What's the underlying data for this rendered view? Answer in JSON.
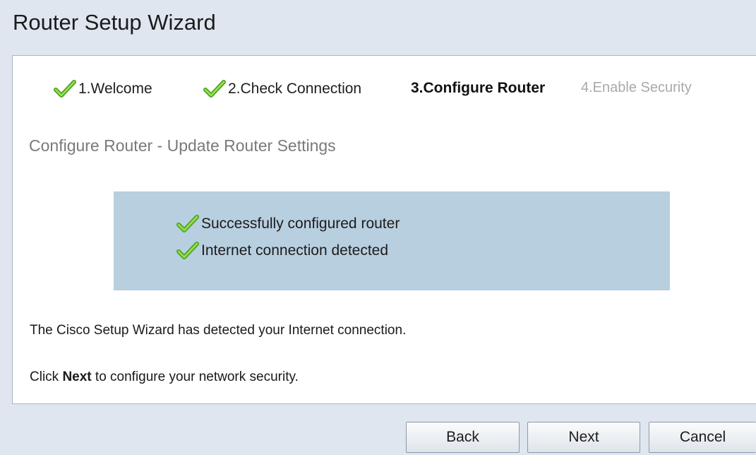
{
  "window": {
    "title": "Router Setup Wizard"
  },
  "steps": [
    {
      "label": "1.Welcome",
      "state": "done",
      "icon": "check-icon"
    },
    {
      "label": "2.Check Connection",
      "state": "done",
      "icon": "check-icon"
    },
    {
      "label": "3.Configure Router",
      "state": "current"
    },
    {
      "label": "4.Enable Security",
      "state": "future"
    }
  ],
  "main": {
    "section_title": "Configure Router - Update Router Settings",
    "status_items": [
      {
        "text": "Successfully configured router",
        "icon": "check-icon"
      },
      {
        "text": "Internet connection detected",
        "icon": "check-icon"
      }
    ],
    "message": "The Cisco Setup Wizard has detected your Internet connection.",
    "instruction": {
      "prefix": "Click ",
      "bold": "Next",
      "suffix": " to configure your network security."
    }
  },
  "buttons": {
    "back": "Back",
    "next": "Next",
    "cancel": "Cancel"
  },
  "colors": {
    "background": "#dfe6ef",
    "panel": "#ffffff",
    "status_box": "#b8cfdf",
    "check_green": "#5fbf2a",
    "muted_text": "#a9a9a9"
  }
}
